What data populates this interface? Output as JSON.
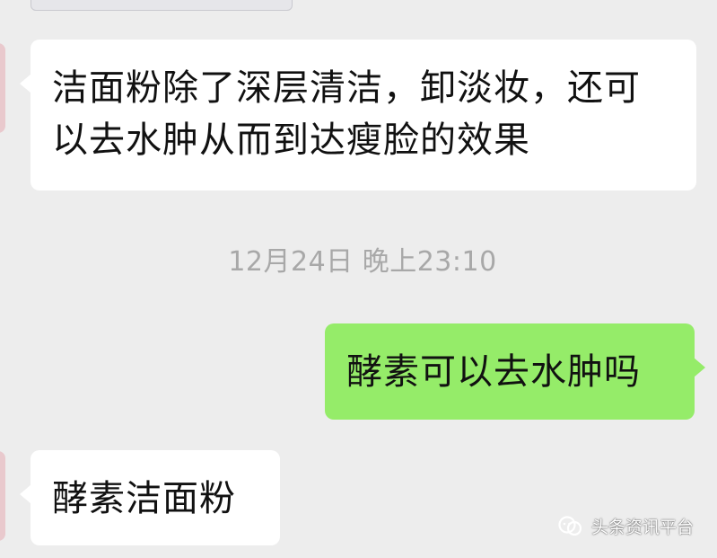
{
  "chat": {
    "messages": [
      {
        "side": "left",
        "text": "洁面粉除了深层清洁，卸淡妆，还可以去水肿从而到达瘦脸的效果"
      },
      {
        "side": "right",
        "text": "酵素可以去水肿吗"
      },
      {
        "side": "left",
        "text": "酵素洁面粉"
      }
    ],
    "timestamp": "12月24日 晚上23:10"
  },
  "watermark": {
    "text": "头条资讯平台",
    "icon": "wechat-official-account-icon"
  },
  "colors": {
    "background": "#ededed",
    "incoming_bubble": "#ffffff",
    "outgoing_bubble": "#95ec69",
    "timestamp": "#a8a8a8"
  }
}
